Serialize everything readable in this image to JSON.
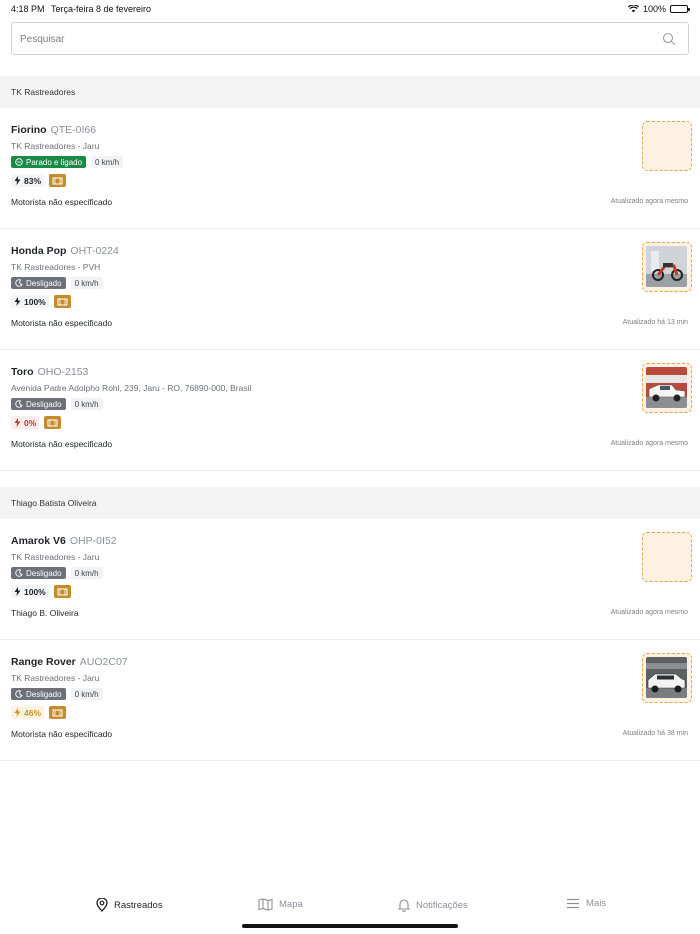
{
  "status_bar": {
    "time": "4:18 PM",
    "date": "Terça-feira 8 de fevereiro",
    "battery": "100%"
  },
  "search": {
    "placeholder": "Pesquisar"
  },
  "groups": [
    {
      "title": "TK Rastreadores",
      "items": [
        {
          "name": "Fiorino",
          "plate": "QTE-0I66",
          "location": "TK Rastreadores - Jaru",
          "status": "Parado e ligado",
          "speed": "0 km/h",
          "battery": "83%",
          "driver": "Motorista não especificado",
          "updated": "Atualizado agora mesmo"
        },
        {
          "name": "Honda Pop",
          "plate": "OHT-0224",
          "location": "TK Rastreadores - PVH",
          "status": "Desligado",
          "speed": "0 km/h",
          "battery": "100%",
          "driver": "Motorista não especificado",
          "updated": "Atualizado há 13 min"
        },
        {
          "name": "Toro",
          "plate": "OHO-2153",
          "location": "Avenida Padre Adolpho Rohl, 239, Jaru - RO, 76890-000, Brasil",
          "status": "Desligado",
          "speed": "0 km/h",
          "battery": "0%",
          "driver": "Motorista não especificado",
          "updated": "Atualizado agora mesmo"
        }
      ]
    },
    {
      "title": "Thiago Batista Oliveira",
      "items": [
        {
          "name": "Amarok V6",
          "plate": "OHP-0I52",
          "location": "TK Rastreadores - Jaru",
          "status": "Desligado",
          "speed": "0 km/h",
          "battery": "100%",
          "driver": "Thiago B. Oliveira",
          "updated": "Atualizado agora mesmo"
        },
        {
          "name": "Range Rover",
          "plate": "AUO2C07",
          "location": "TK Rastreadores - Jaru",
          "status": "Desligado",
          "speed": "0 km/h",
          "battery": "46%",
          "driver": "Motorista não especificado",
          "updated": "Atualizado há 38 min"
        }
      ]
    }
  ],
  "tabs": [
    {
      "label": "Rastreados",
      "icon": "location-pin-icon",
      "active": true
    },
    {
      "label": "Mapa",
      "icon": "map-icon",
      "active": false
    },
    {
      "label": "Notificações",
      "icon": "bell-icon",
      "active": false
    },
    {
      "label": "Mais",
      "icon": "menu-icon",
      "active": false
    }
  ],
  "colors": {
    "running_badge": "#1a8a47",
    "off_badge": "#6b7079",
    "relay": "#c48c2c",
    "thumb_border": "#f0a24a"
  }
}
